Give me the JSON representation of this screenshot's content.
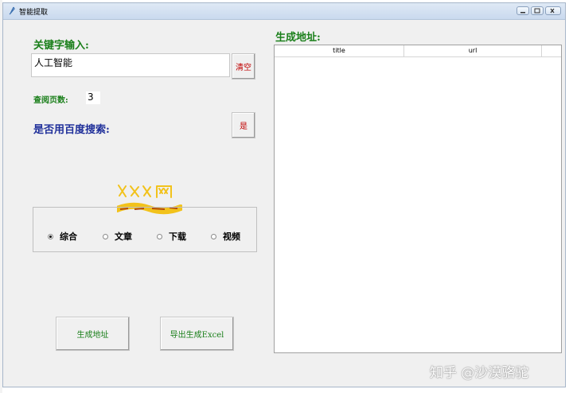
{
  "window": {
    "title": "智能提取"
  },
  "keyword": {
    "label": "关键字输入:",
    "value": "人工智能",
    "clear_label": "清空"
  },
  "pages": {
    "label": "查阅页数:",
    "value": "3"
  },
  "baidu": {
    "label": "是否用百度搜索:",
    "toggle_label": "是"
  },
  "watermark": {
    "logo_text": "XXX网"
  },
  "search_type": {
    "options": [
      "综合",
      "文章",
      "下载",
      "视频"
    ],
    "selected": "综合"
  },
  "actions": {
    "generate_label": "生成地址",
    "export_label": "导出生成Excel"
  },
  "results": {
    "label": "生成地址:",
    "columns": [
      "title",
      "url"
    ]
  },
  "footer_watermark": "知乎 @沙漠骆驼",
  "colors": {
    "green": "#1a7f1a",
    "blue": "#1f2f9a",
    "red": "#c00000",
    "logo": "#f2c21b"
  }
}
